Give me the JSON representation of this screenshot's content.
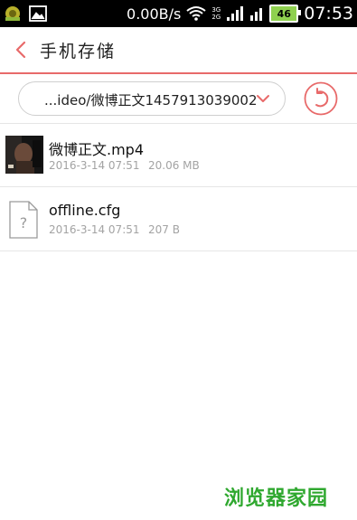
{
  "status_bar": {
    "net_speed": "0.00B/s",
    "network_3g": "3G",
    "network_2g": "2G",
    "battery": "46",
    "time": "07:53",
    "icons": [
      "app-notification-icon",
      "image-notification-icon",
      "wifi-icon",
      "signal-icon",
      "battery-icon"
    ]
  },
  "header": {
    "title": "手机存储",
    "back_icon": "chevron-left-icon"
  },
  "path_bar": {
    "path": "...ideo/微博正文1457913039002",
    "dropdown_icon": "chevron-down-icon",
    "refresh_icon": "undo-icon"
  },
  "files": [
    {
      "name": "微博正文.mp4",
      "date": "2016-3-14 07:51",
      "size": "20.06 MB",
      "icon": "video-thumbnail"
    },
    {
      "name": "offline.cfg",
      "date": "2016-3-14 07:51",
      "size": "207 B",
      "icon": "unknown-file-icon"
    }
  ],
  "watermark": "浏览器家园",
  "colors": {
    "accent": "#e86a6a",
    "text_primary": "#111111",
    "text_secondary": "#a3a3a3",
    "watermark": "#2fa82f"
  }
}
